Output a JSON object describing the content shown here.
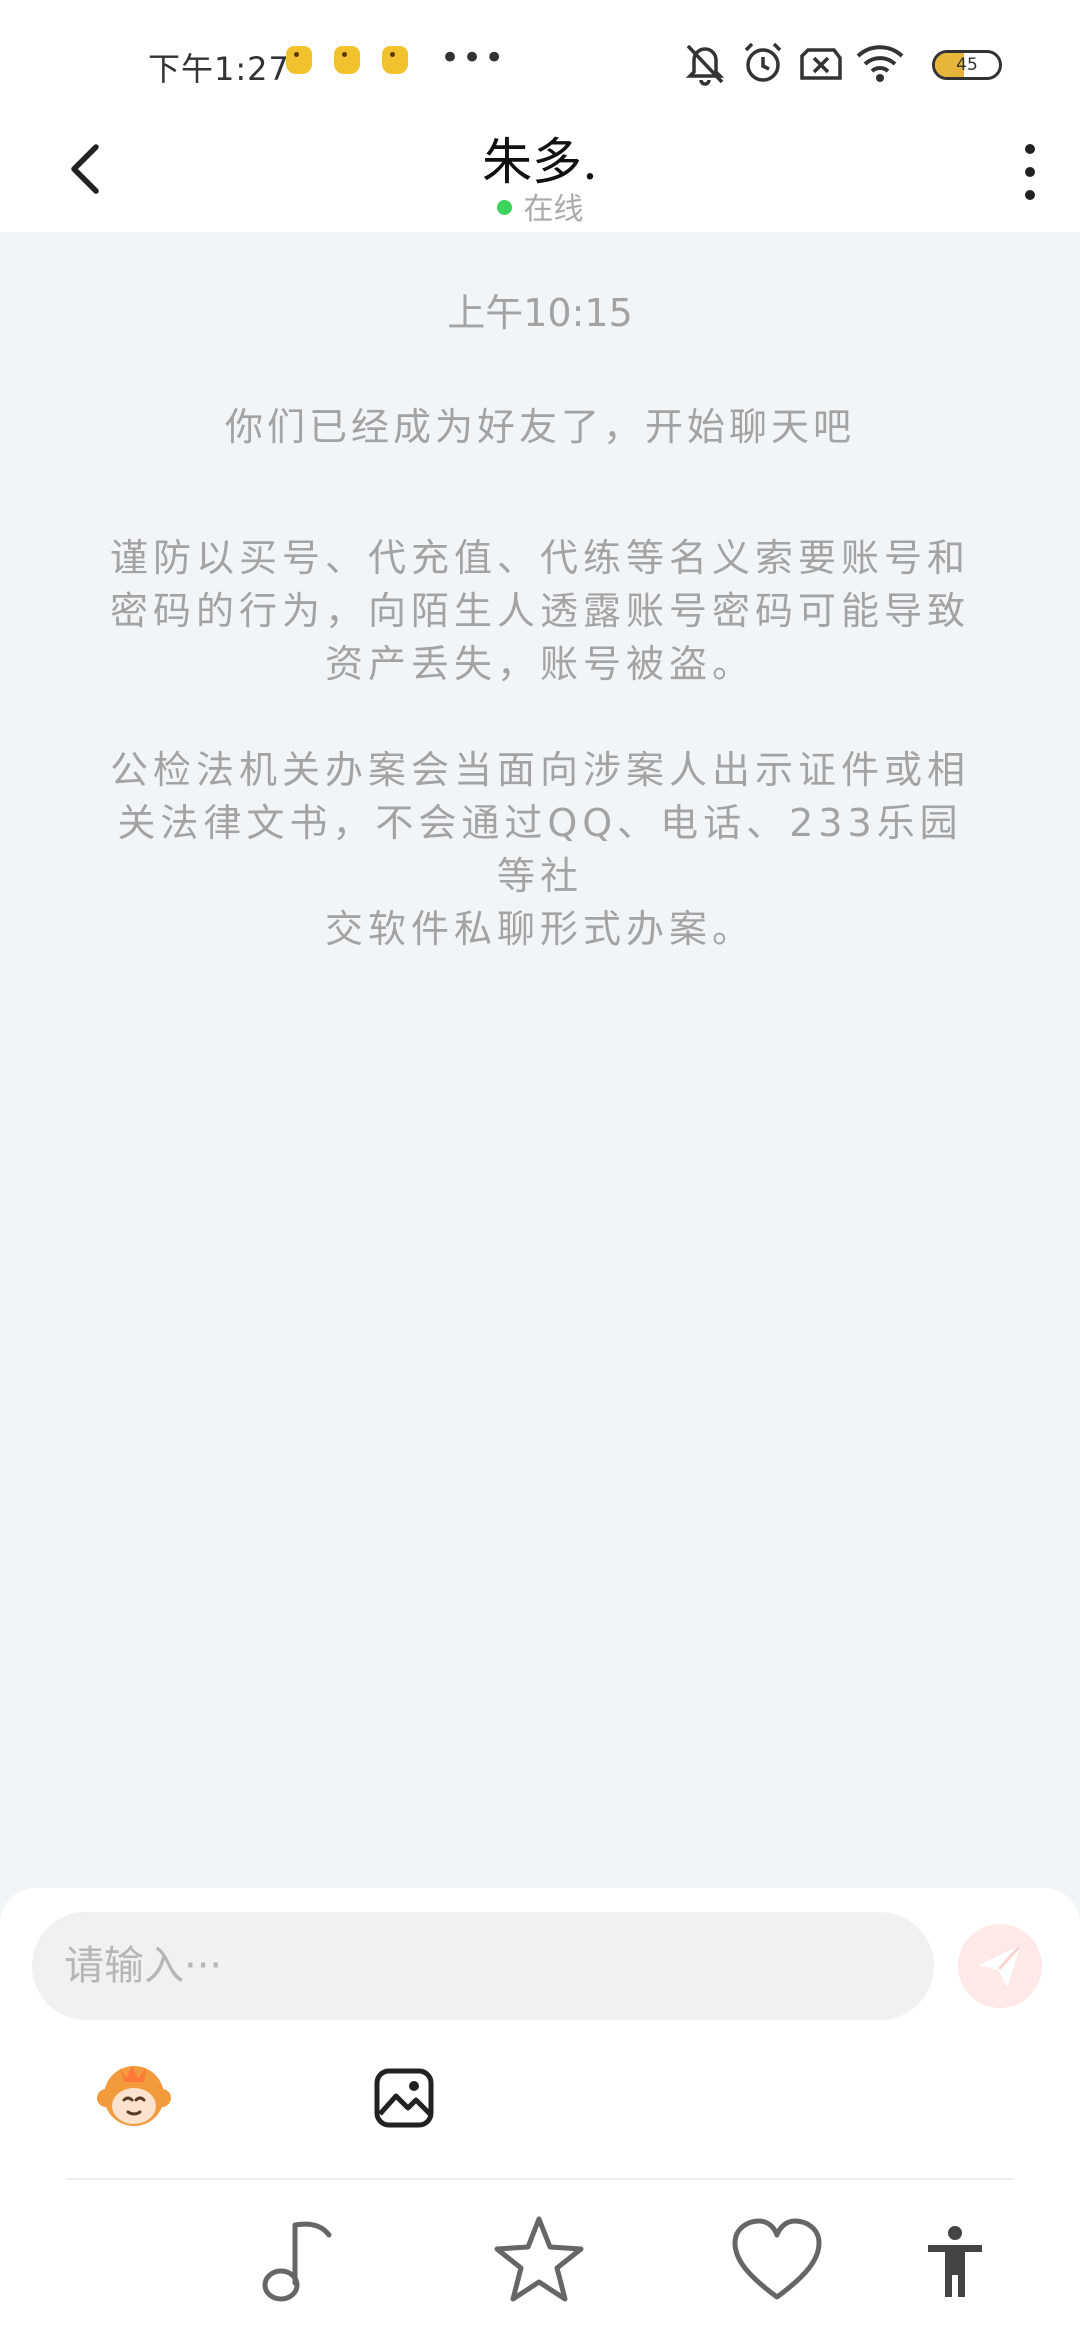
{
  "status_bar": {
    "time": "下午1:27",
    "more": "•••",
    "battery_level": "45",
    "icons": [
      "dnd-bell-off-icon",
      "alarm-icon",
      "sim-x-icon",
      "wifi-icon",
      "battery-icon"
    ]
  },
  "header": {
    "title": "朱多.",
    "status": "在线",
    "status_color": "#3bd35b"
  },
  "messages": {
    "time": "上午10:15",
    "friend_notice": "你们已经成为好友了，开始聊天吧",
    "warning_1_lines": [
      "谨防以买号、代充值、代练等名义索要账号和",
      "密码的行为，向陌生人透露账号密码可能导致",
      "资产丢失，账号被盗。"
    ],
    "warning_2_lines": [
      "公检法机关办案会当面向涉案人出示证件或相",
      "关法律文书，不会通过QQ、电话、233乐园等社",
      "交软件私聊形式办案。"
    ]
  },
  "input": {
    "placeholder": "请输入···",
    "value": ""
  },
  "colors": {
    "background": "#f2f5f8",
    "send_button": "#ffe8e8",
    "muted_text": "#a3a3a3"
  }
}
